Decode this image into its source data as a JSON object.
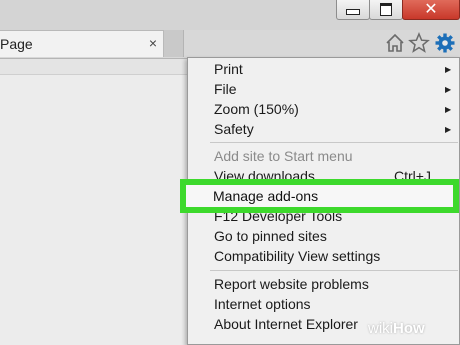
{
  "window": {
    "controls": {
      "minimize_icon": "minimize-icon",
      "maximize_icon": "maximize-icon",
      "close_glyph": "✕"
    }
  },
  "tab": {
    "title": "Page",
    "close_glyph": "×"
  },
  "toolbar": {
    "icons": [
      "home-icon",
      "star-icon",
      "gear-icon"
    ],
    "gear_color": "#1d6fb8"
  },
  "menu": {
    "items": [
      {
        "label": "Print",
        "submenu": true
      },
      {
        "label": "File",
        "submenu": true
      },
      {
        "label": "Zoom (150%)",
        "submenu": true
      },
      {
        "label": "Safety",
        "submenu": true
      },
      {
        "label": "Add site to Start menu",
        "disabled": true
      },
      {
        "label": "View downloads",
        "shortcut": "Ctrl+J"
      },
      {
        "label": "Manage add-ons",
        "highlighted": true
      },
      {
        "label": "F12 Developer Tools"
      },
      {
        "label": "Go to pinned sites"
      },
      {
        "label": "Compatibility View settings"
      },
      {
        "label": "Report website problems"
      },
      {
        "label": "Internet options"
      },
      {
        "label": "About Internet Explorer"
      }
    ],
    "arrow_glyph": "▶"
  },
  "highlight_color": "#3dd92c",
  "watermark": {
    "wiki": "wiki",
    "how": "How"
  }
}
